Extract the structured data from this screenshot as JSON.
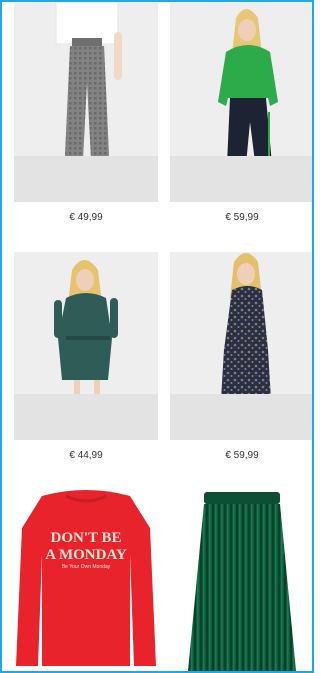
{
  "products": [
    {
      "name": "grey-check-trousers",
      "price": "€ 49,99"
    },
    {
      "name": "green-sweater-outfit",
      "price": "€ 59,99"
    },
    {
      "name": "green-print-dress",
      "price": "€ 44,99"
    },
    {
      "name": "navy-print-maxi-dress",
      "price": "€ 59,99"
    },
    {
      "name": "red-sweatshirt",
      "slogan_line1": "DON'T BE",
      "slogan_line2": "A MONDAY",
      "slogan_small": "Be Your Own Monday"
    },
    {
      "name": "green-pleated-skirt"
    }
  ],
  "colors": {
    "frame": "#21a7e3",
    "sweatshirt": "#e8232b",
    "skirt": "#0f5a3c",
    "price_text": "#333333"
  }
}
